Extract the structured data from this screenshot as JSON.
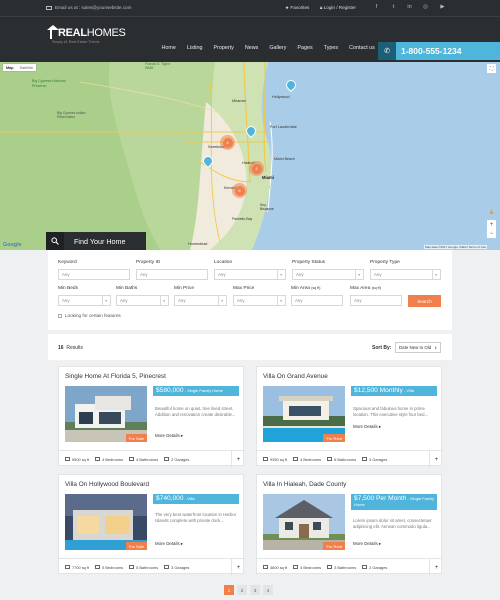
{
  "topbar": {
    "email": "Email us at : sales@yourwebsite.com",
    "favorites": "Favorites",
    "login": "Login / Register"
  },
  "logo": {
    "text_bold": "REAL",
    "text_regular": "HOMES",
    "tagline": "Simply #1 Real Estate Theme"
  },
  "nav": [
    "Home",
    "Listing",
    "Property",
    "News",
    "Gallery",
    "Pages",
    "Types",
    "Contact us"
  ],
  "phone": "1-800-555-1234",
  "map": {
    "types": [
      "Map",
      "Satellite"
    ],
    "cities": [
      "Big Cypress National Preserve",
      "Big Cypress Indian Reservation",
      "Francis S. Taylor WMA",
      "Fort Lauderdale",
      "Hollywood",
      "Miramar",
      "Hialeah",
      "Miami",
      "Miami Beach",
      "Kendall",
      "Homestead",
      "Key Biscayne",
      "Palmetto Bay",
      "Sweetwater"
    ],
    "clusters": [
      "4",
      "4",
      "6"
    ],
    "attribution": "Map data ©2017 Google, INEGI   Terms of Use",
    "google": "Google"
  },
  "find_label": "Find Your Home",
  "form": {
    "keyword": {
      "label": "Keyword",
      "placeholder": "Any"
    },
    "property_id": {
      "label": "Property ID",
      "placeholder": "Any"
    },
    "location": {
      "label": "Location",
      "value": "Any"
    },
    "status": {
      "label": "Property Status",
      "value": "Any"
    },
    "type": {
      "label": "Property Type",
      "value": "Any"
    },
    "min_beds": {
      "label": "Min Beds",
      "value": "Any"
    },
    "min_baths": {
      "label": "Min Baths",
      "value": "Any"
    },
    "min_price": {
      "label": "Min Price",
      "value": "Any"
    },
    "max_price": {
      "label": "Max Price",
      "value": "Any"
    },
    "min_area": {
      "label": "Min Area",
      "unit": "(sq ft)",
      "placeholder": "Any"
    },
    "max_area": {
      "label": "Max Area",
      "unit": "(sq ft)",
      "placeholder": "Any"
    },
    "search_label": "Search",
    "features_label": "Looking for certain features"
  },
  "results": {
    "count": "16",
    "label": "Results",
    "sort_label": "Sort By:",
    "sort_value": "Date New to Old"
  },
  "cards": [
    {
      "title": "Single Home At Florida 5, Pinecrest",
      "price": "$580,000",
      "ptype": "- Single Family Home",
      "badge": "For Sale",
      "desc": "Beautiful home on quiet, tree lined street. Addition and renovation create desirable...",
      "more": "More Details",
      "area": "5500 sq ft",
      "beds": "4 Bedrooms",
      "baths": "4 Bathrooms",
      "garages": "2 Garages"
    },
    {
      "title": "Villa On Grand Avenue",
      "price": "$12,500 Monthly",
      "ptype": "- Villa",
      "badge": "For Rent",
      "desc": "Spacious and fabulous home in prime location. This executive style four bed...",
      "more": "More Details",
      "area": "9350 sq ft",
      "beds": "4 Bedrooms",
      "baths": "6 Bathrooms",
      "garages": "4 Garages"
    },
    {
      "title": "Villa On Hollywood Boulevard",
      "price": "$740,000",
      "ptype": "- Villa",
      "badge": "For Sale",
      "desc": "The very best waterfront location in Harbor Islands complete with private dock...",
      "more": "More Details",
      "area": "7700 sq ft",
      "beds": "5 Bedrooms",
      "baths": "5 Bathrooms",
      "garages": "3 Garages"
    },
    {
      "title": "Villa In Hialeah, Dade County",
      "price": "$7,500 Per Month",
      "ptype": "- Single Family Home",
      "badge": "For Rent",
      "desc": "Lorem ipsum dolor sit amet, consectetuer adipiscing elit. Aenean commodo ligula...",
      "more": "More Details",
      "area": "4800 sq ft",
      "beds": "4 Bedrooms",
      "baths": "3 Bathrooms",
      "garages": "2 Garages"
    }
  ],
  "pagination": [
    "1",
    "2",
    "3",
    "4"
  ],
  "colors": {
    "accent_blue": "#4fb5db",
    "accent_orange": "#f07f4b",
    "header_dark": "#2b2e31"
  }
}
